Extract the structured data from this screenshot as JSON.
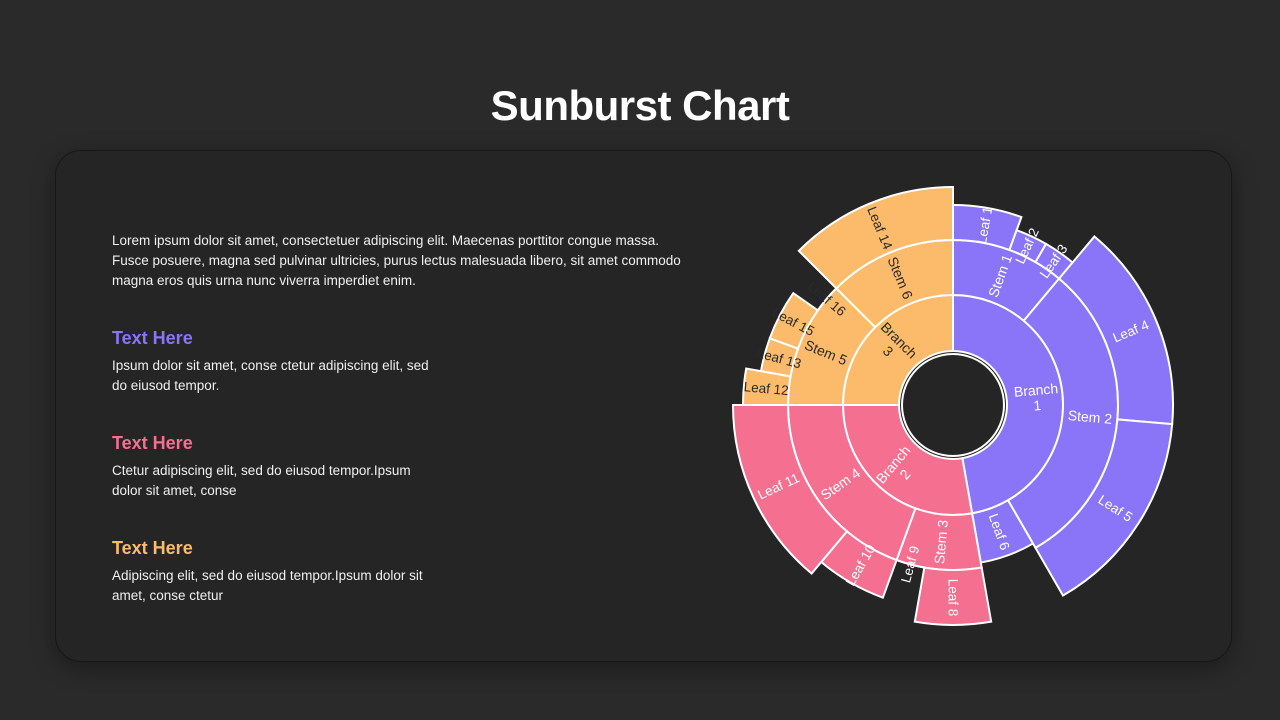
{
  "title": "Sunburst Chart",
  "intro": "Lorem ipsum dolor sit amet, consectetuer adipiscing elit. Maecenas porttitor congue massa. Fusce posuere, magna sed pulvinar ultricies, purus lectus malesuada libero, sit amet commodo magna eros quis  urna nunc viverra imperdiet enim.",
  "sections": [
    {
      "heading": "Text Here",
      "text": "Ipsum dolor sit amet, conse ctetur adipiscing elit, sed do eiusod tempor.",
      "color": "#8a74f8"
    },
    {
      "heading": "Text Here",
      "text": "Ctetur adipiscing elit, sed do eiusod tempor.Ipsum dolor sit amet, conse",
      "color": "#f46f90"
    },
    {
      "heading": "Text Here",
      "text": "Adipiscing elit, sed do eiusod tempor.Ipsum dolor sit amet, conse ctetur",
      "color": "#fcbb6b"
    }
  ],
  "chart_data": {
    "type": "sunburst",
    "branches": [
      {
        "name": "Branch 1",
        "color": "#8a74f8",
        "stems": [
          {
            "name": "Stem 1",
            "leaves": [
              {
                "name": "Leaf 1",
                "value": 4
              },
              {
                "name": "Leaf 2",
                "value": 2
              },
              {
                "name": "Leaf 3",
                "value": 2
              }
            ]
          },
          {
            "name": "Stem 2",
            "leaves": [
              {
                "name": "Leaf 4",
                "value": 11
              },
              {
                "name": "Leaf 5",
                "value": 11
              }
            ]
          },
          {
            "name": "",
            "leaves": [
              {
                "name": "Leaf 6",
                "value": 4
              }
            ]
          }
        ]
      },
      {
        "name": "Branch 2",
        "color": "#f46f90",
        "stems": [
          {
            "name": "Stem 3",
            "leaves": [
              {
                "name": "Leaf 8",
                "value": 4
              },
              {
                "name": "Leaf 9",
                "value": 2
              }
            ]
          },
          {
            "name": "Stem 4",
            "leaves": [
              {
                "name": "Leaf 10",
                "value": 4
              },
              {
                "name": "Leaf 11",
                "value": 10
              }
            ]
          }
        ]
      },
      {
        "name": "Branch 3",
        "color": "#fcbb6b",
        "stems": [
          {
            "name": "Stem 5",
            "leaves": [
              {
                "name": "Leaf 12",
                "value": 2
              },
              {
                "name": "Leaf 13",
                "value": 2
              },
              {
                "name": "Leaf 15",
                "value": 3
              },
              {
                "name": "Leaf 16",
                "value": 2
              }
            ]
          },
          {
            "name": "Stem 6",
            "leaves": [
              {
                "name": "Leaf 14",
                "value": 9
              }
            ]
          }
        ]
      }
    ]
  }
}
